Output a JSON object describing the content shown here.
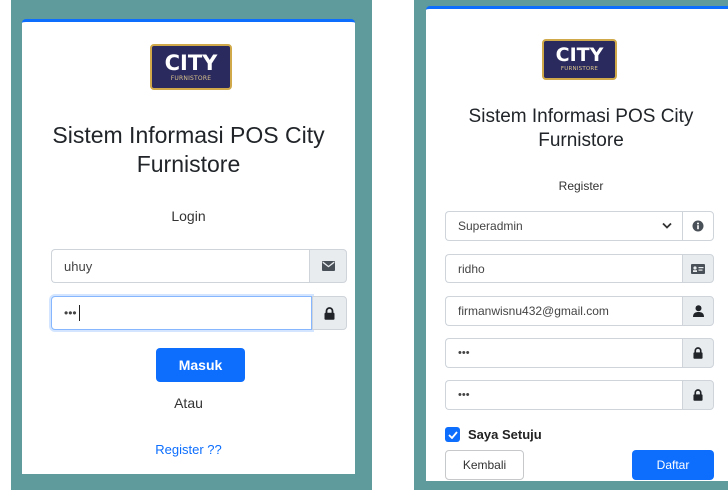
{
  "login": {
    "logo_main": "CITY",
    "logo_sub": "FURNISTORE",
    "title_line1": "Sistem Informasi POS City",
    "title_line2": "Furnistore",
    "subtitle": "Login",
    "username_value": "uhuy",
    "password_value": "•••",
    "submit_label": "Masuk",
    "or_label": "Atau",
    "register_link": "Register ??"
  },
  "register": {
    "logo_main": "CITY",
    "logo_sub": "FURNISTORE",
    "title_line1": "Sistem Informasi POS City",
    "title_line2": "Furnistore",
    "subtitle": "Register",
    "role_selected": "Superadmin",
    "name_value": "ridho",
    "email_value": "firmanwisnu432@gmail.com",
    "password_value": "•••",
    "confirm_password_value": "•••",
    "agree_label": "Saya Setuju",
    "agree_checked": true,
    "back_label": "Kembali",
    "submit_label": "Daftar"
  },
  "colors": {
    "background_panel": "#5f9b9d",
    "primary": "#0d6efd",
    "logo_bg": "#2b2a5f"
  },
  "icons": {
    "username": "envelope-icon",
    "password": "lock-icon",
    "role": "info-icon",
    "name": "id-card-icon",
    "email": "user-icon",
    "select": "chevron-down-icon",
    "checkbox": "checkmark-icon"
  }
}
